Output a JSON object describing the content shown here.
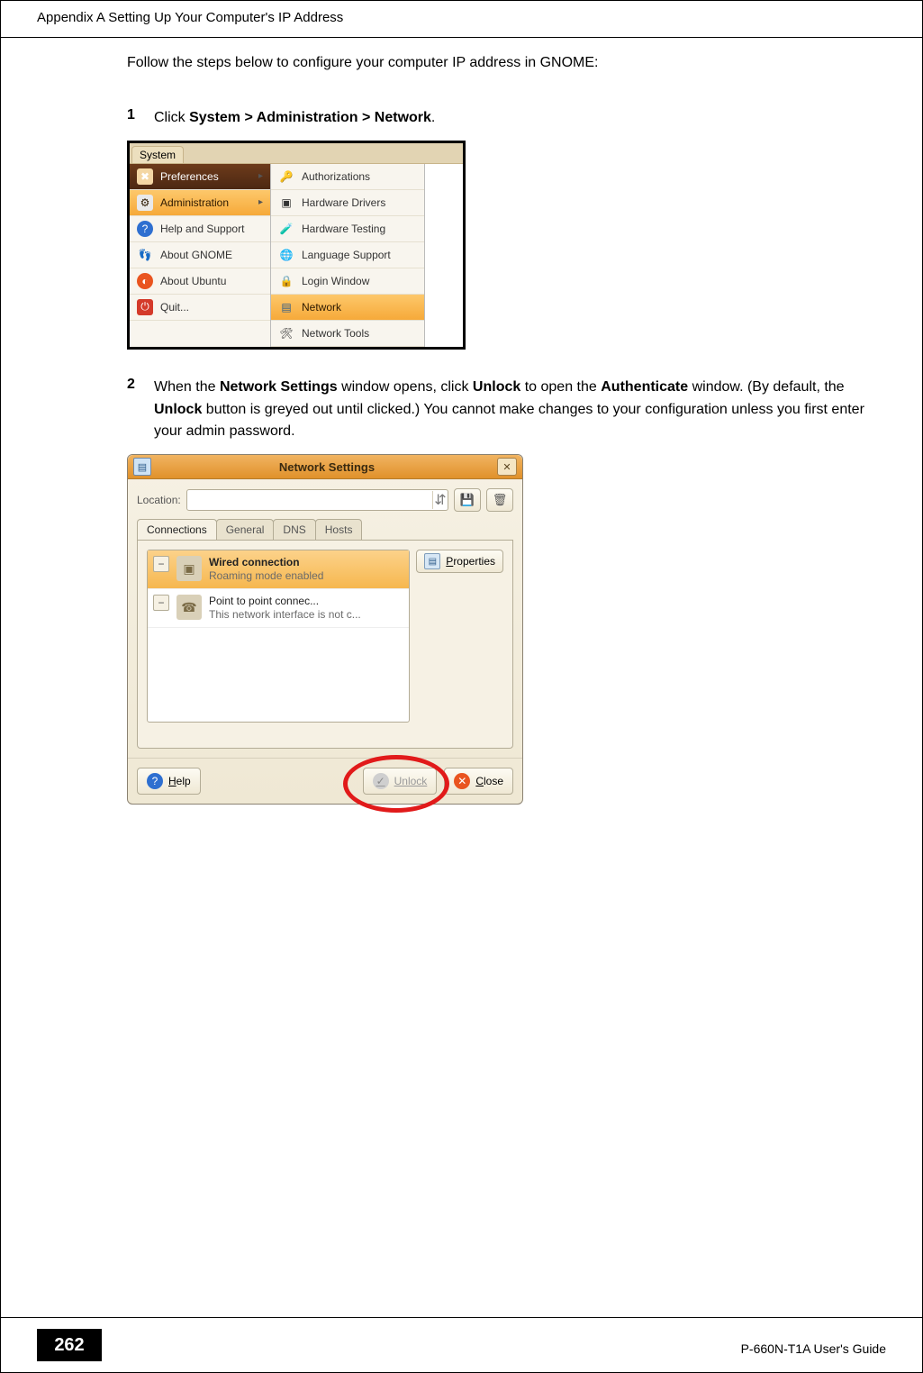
{
  "header": {
    "appendix_title": "Appendix A Setting Up Your Computer's IP Address"
  },
  "intro": "Follow the steps below to configure your computer IP address in GNOME:",
  "step1": {
    "num": "1",
    "pre": "Click ",
    "bold": "System > Administration > Network",
    "post": "."
  },
  "menu": {
    "button": "System",
    "left": {
      "preferences": "Preferences",
      "administration": "Administration",
      "help": "Help and Support",
      "about_gnome": "About GNOME",
      "about_ubuntu": "About Ubuntu",
      "quit": "Quit..."
    },
    "right": {
      "authorizations": "Authorizations",
      "hardware_drivers": "Hardware Drivers",
      "hardware_testing": "Hardware Testing",
      "language_support": "Language Support",
      "login_window": "Login Window",
      "network": "Network",
      "network_tools": "Network Tools"
    }
  },
  "step2": {
    "num": "2",
    "t0": "When the ",
    "b0": "Network Settings",
    "t1": " window opens, click ",
    "b1": "Unlock",
    "t2": " to open the ",
    "b2": "Authenticate",
    "t3": " window. (By default, the ",
    "b3": "Unlock",
    "t4": " button is greyed out until clicked.) You cannot make changes to your configuration unless you first enter your admin password."
  },
  "window": {
    "title": "Network Settings",
    "location_label": "Location:",
    "tabs": {
      "connections": "Connections",
      "general": "General",
      "dns": "DNS",
      "hosts": "Hosts"
    },
    "properties_u": "P",
    "properties_rest": "roperties",
    "conn1": {
      "title": "Wired connection",
      "sub": "Roaming mode enabled"
    },
    "conn2": {
      "title": "Point to point connec...",
      "sub": "This network interface is not c..."
    },
    "help_u": "H",
    "help_rest": "elp",
    "unlock": "Unlock",
    "close_u": "C",
    "close_rest": "lose"
  },
  "footer": {
    "page": "262",
    "guide": "P-660N-T1A User's Guide"
  }
}
